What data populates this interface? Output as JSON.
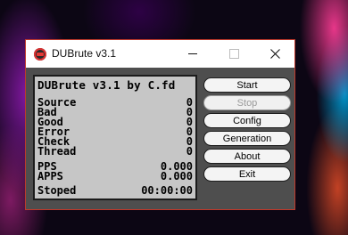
{
  "window": {
    "title": "DUBrute v3.1",
    "app_icon": "dubrute-app-icon",
    "controls": {
      "minimize": "minimize-icon",
      "maximize": "maximize-icon",
      "close": "close-icon"
    }
  },
  "panel": {
    "title": "DUBrute v3.1 by C.fd",
    "stats": [
      {
        "label": "Source",
        "value": "0"
      },
      {
        "label": "Bad",
        "value": "0"
      },
      {
        "label": "Good",
        "value": "0"
      },
      {
        "label": "Error",
        "value": "0"
      },
      {
        "label": "Check",
        "value": "0"
      },
      {
        "label": "Thread",
        "value": "0"
      }
    ],
    "rates": [
      {
        "label": "PPS",
        "value": "0.000"
      },
      {
        "label": "APPS",
        "value": "0.000"
      }
    ],
    "status": {
      "label": "Stoped",
      "time": "00:00:00"
    }
  },
  "buttons": {
    "start": "Start",
    "stop": "Stop",
    "config": "Config",
    "generation": "Generation",
    "about": "About",
    "exit": "Exit"
  },
  "colors": {
    "window_border": "#c0392b",
    "window_bg": "#4e4e4e",
    "panel_bg": "#c6c6c6"
  }
}
